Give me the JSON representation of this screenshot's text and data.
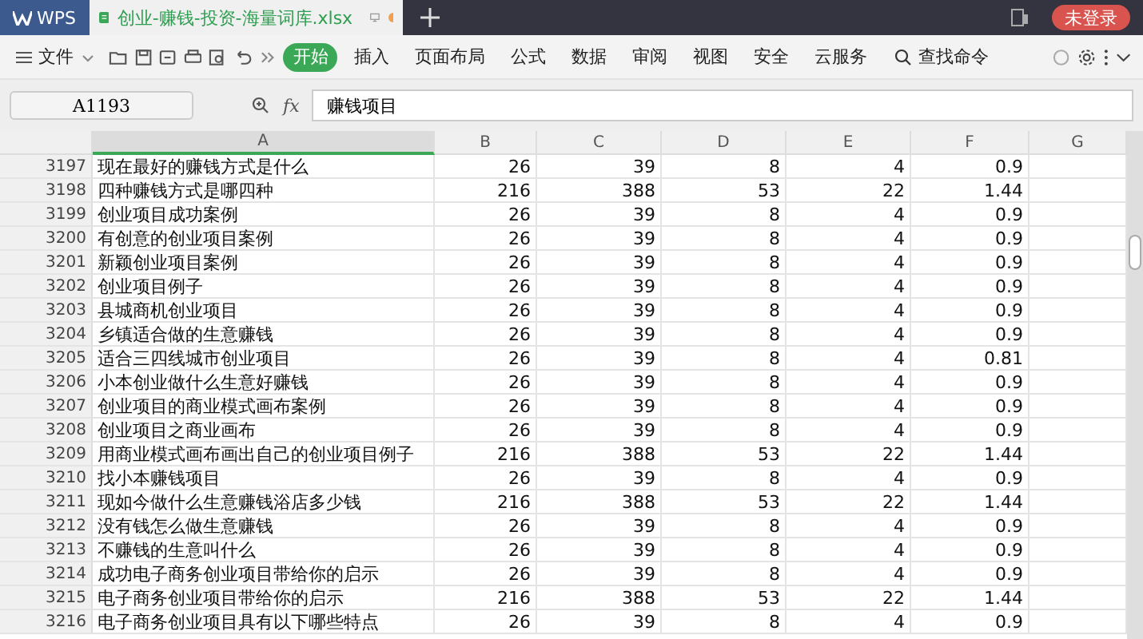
{
  "app_tab": {
    "label": "WPS"
  },
  "file_tab": {
    "label": "创业-赚钱-投资-海量词库.xlsx"
  },
  "login_button": {
    "label": "未登录"
  },
  "file_menu": {
    "label": "文件"
  },
  "ribbon_tabs": [
    {
      "label": "开始",
      "selected": true
    },
    {
      "label": "插入",
      "selected": false
    },
    {
      "label": "页面布局",
      "selected": false
    },
    {
      "label": "公式",
      "selected": false
    },
    {
      "label": "数据",
      "selected": false
    },
    {
      "label": "审阅",
      "selected": false
    },
    {
      "label": "视图",
      "selected": false
    },
    {
      "label": "安全",
      "selected": false
    },
    {
      "label": "云服务",
      "selected": false
    }
  ],
  "command_search": {
    "label": "查找命令"
  },
  "name_box": {
    "value": "A1193"
  },
  "formula_bar": {
    "fx": "fx",
    "value": "赚钱项目"
  },
  "columns": [
    {
      "label": "A",
      "selected": true
    },
    {
      "label": "B",
      "selected": false
    },
    {
      "label": "C",
      "selected": false
    },
    {
      "label": "D",
      "selected": false
    },
    {
      "label": "E",
      "selected": false
    },
    {
      "label": "F",
      "selected": false
    },
    {
      "label": "G",
      "selected": false
    }
  ],
  "rows": [
    {
      "num": "3197",
      "cells": [
        "现在最好的赚钱方式是什么",
        "26",
        "39",
        "8",
        "4",
        "0.9"
      ]
    },
    {
      "num": "3198",
      "cells": [
        "四种赚钱方式是哪四种",
        "216",
        "388",
        "53",
        "22",
        "1.44"
      ]
    },
    {
      "num": "3199",
      "cells": [
        "创业项目成功案例",
        "26",
        "39",
        "8",
        "4",
        "0.9"
      ]
    },
    {
      "num": "3200",
      "cells": [
        "有创意的创业项目案例",
        "26",
        "39",
        "8",
        "4",
        "0.9"
      ]
    },
    {
      "num": "3201",
      "cells": [
        "新颖创业项目案例",
        "26",
        "39",
        "8",
        "4",
        "0.9"
      ]
    },
    {
      "num": "3202",
      "cells": [
        "创业项目例子",
        "26",
        "39",
        "8",
        "4",
        "0.9"
      ]
    },
    {
      "num": "3203",
      "cells": [
        "县城商机创业项目",
        "26",
        "39",
        "8",
        "4",
        "0.9"
      ]
    },
    {
      "num": "3204",
      "cells": [
        "乡镇适合做的生意赚钱",
        "26",
        "39",
        "8",
        "4",
        "0.9"
      ]
    },
    {
      "num": "3205",
      "cells": [
        "适合三四线城市创业项目",
        "26",
        "39",
        "8",
        "4",
        "0.81"
      ]
    },
    {
      "num": "3206",
      "cells": [
        "小本创业做什么生意好赚钱",
        "26",
        "39",
        "8",
        "4",
        "0.9"
      ]
    },
    {
      "num": "3207",
      "cells": [
        "创业项目的商业模式画布案例",
        "26",
        "39",
        "8",
        "4",
        "0.9"
      ]
    },
    {
      "num": "3208",
      "cells": [
        "创业项目之商业画布",
        "26",
        "39",
        "8",
        "4",
        "0.9"
      ]
    },
    {
      "num": "3209",
      "cells": [
        "用商业模式画布画出自己的创业项目例子",
        "216",
        "388",
        "53",
        "22",
        "1.44"
      ]
    },
    {
      "num": "3210",
      "cells": [
        "找小本赚钱项目",
        "26",
        "39",
        "8",
        "4",
        "0.9"
      ]
    },
    {
      "num": "3211",
      "cells": [
        "现如今做什么生意赚钱浴店多少钱",
        "216",
        "388",
        "53",
        "22",
        "1.44"
      ]
    },
    {
      "num": "3212",
      "cells": [
        "没有钱怎么做生意赚钱",
        "26",
        "39",
        "8",
        "4",
        "0.9"
      ]
    },
    {
      "num": "3213",
      "cells": [
        "不赚钱的生意叫什么",
        "26",
        "39",
        "8",
        "4",
        "0.9"
      ]
    },
    {
      "num": "3214",
      "cells": [
        "成功电子商务创业项目带给你的启示",
        "26",
        "39",
        "8",
        "4",
        "0.9"
      ]
    },
    {
      "num": "3215",
      "cells": [
        "电子商务创业项目带给你的启示",
        "216",
        "388",
        "53",
        "22",
        "1.44"
      ]
    },
    {
      "num": "3216",
      "cells": [
        "电子商务创业项目具有以下哪些特点",
        "26",
        "39",
        "8",
        "4",
        "0.9"
      ]
    }
  ]
}
